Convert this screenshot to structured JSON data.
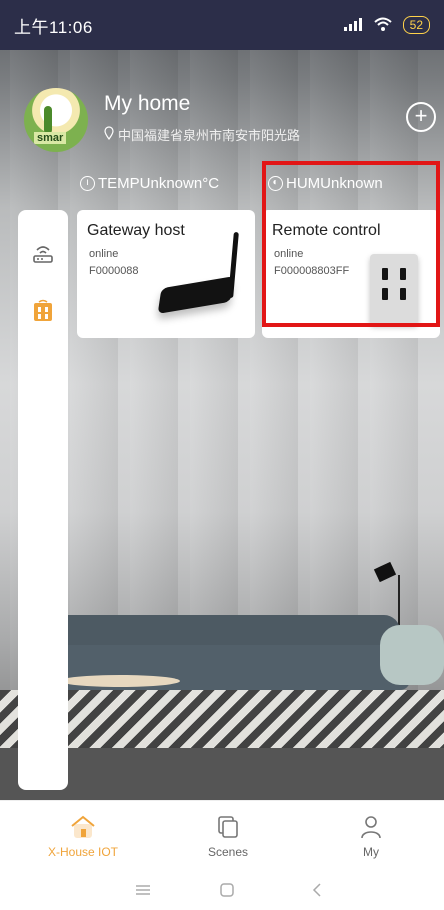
{
  "status_bar": {
    "time": "上午11:06",
    "battery": "52"
  },
  "header": {
    "avatar_text": "smar",
    "home_name": "My home",
    "location": "中国福建省泉州市南安市阳光路"
  },
  "sensors": {
    "temp": "TEMPUnknown°C",
    "hum": "HUMUnknown"
  },
  "cards": [
    {
      "name": "Gateway host",
      "status": "online",
      "serial": "F0000088"
    },
    {
      "name": "Remote control",
      "status": "online",
      "serial": "F000008803FF"
    }
  ],
  "nav": {
    "items": [
      {
        "label": "X-House IOT",
        "icon": "home-icon",
        "active": true
      },
      {
        "label": "Scenes",
        "icon": "scenes-icon",
        "active": false
      },
      {
        "label": "My",
        "icon": "person-icon",
        "active": false
      }
    ]
  },
  "colors": {
    "accent": "#f0a43a",
    "status_bar": "#2c2e49",
    "highlight": "#e21616"
  }
}
